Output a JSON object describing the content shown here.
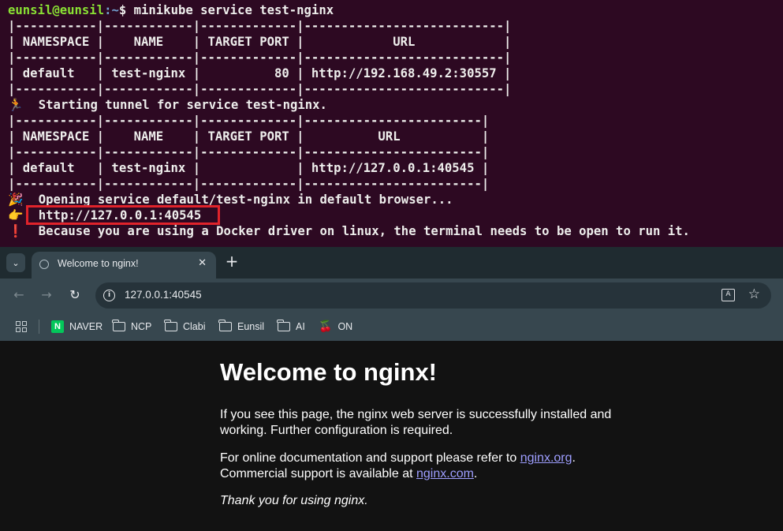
{
  "terminal": {
    "prompt_user": "eunsil@eunsil",
    "prompt_path": ":~",
    "prompt_symbol": "$ ",
    "command": "minikube service test-nginx",
    "table1": {
      "border": "|-----------|------------|-------------|---------------------------|",
      "header": "| NAMESPACE |    NAME    | TARGET PORT |            URL            |",
      "row": "| default   | test-nginx |          80 | http://192.168.49.2:30557 |"
    },
    "tunnel_emoji": "🏃",
    "tunnel_msg": "  Starting tunnel for service test-nginx.",
    "table2": {
      "border": "|-----------|------------|-------------|------------------------|",
      "header": "| NAMESPACE |    NAME    | TARGET PORT |          URL           |",
      "row": "| default   | test-nginx |             | http://127.0.0.1:40545 |"
    },
    "opening_emoji": "🎉",
    "opening_msg": "  Opening service default/test-nginx in default browser...",
    "url_emoji": "👉",
    "url_msg": "  http://127.0.0.1:40545",
    "warn_emoji": "❗",
    "warn_msg": "  Because you are using a Docker driver on linux, the terminal needs to be open to run it."
  },
  "browser": {
    "tab_search_icon": "⌄",
    "tab_title": "Welcome to nginx!",
    "tab_close": "✕",
    "new_tab": "+",
    "back_icon": "←",
    "forward_icon": "→",
    "reload_icon": "↻",
    "url": "127.0.0.1:40545",
    "bookmarks": [
      {
        "label": "NAVER"
      },
      {
        "label": "NCP"
      },
      {
        "label": "Clabi"
      },
      {
        "label": "Eunsil"
      },
      {
        "label": "AI"
      },
      {
        "label": "ON"
      }
    ]
  },
  "page": {
    "title": "Welcome to nginx!",
    "p1": "If you see this page, the nginx web server is successfully installed and working. Further configuration is required.",
    "p2_prefix": "For online documentation and support please refer to ",
    "p2_link1": "nginx.org",
    "p2_mid": ".",
    "p2_line2": "Commercial support is available at ",
    "p2_link2": "nginx.com",
    "p2_end": ".",
    "p3": "Thank you for using nginx."
  },
  "colors": {
    "terminal_bg": "#2d0922",
    "highlight": "#e0232b",
    "link": "#9e9eff"
  }
}
